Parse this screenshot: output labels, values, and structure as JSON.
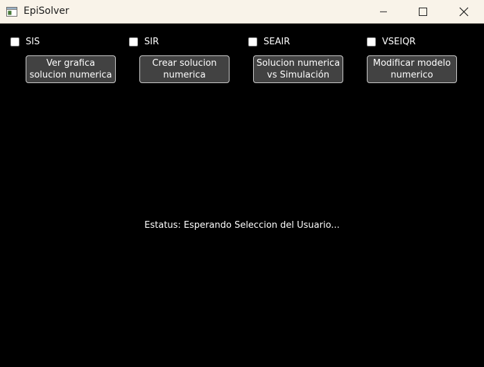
{
  "window": {
    "title": "EpiSolver",
    "icon": "app-window-icon",
    "controls": {
      "minimize_icon": "minimize-icon",
      "maximize_icon": "maximize-icon",
      "close_icon": "close-icon"
    }
  },
  "checkboxes": [
    {
      "label": "SIS",
      "checked": false
    },
    {
      "label": "SIR",
      "checked": false
    },
    {
      "label": "SEAIR",
      "checked": false
    },
    {
      "label": "VSEIQR",
      "checked": false
    }
  ],
  "buttons": [
    {
      "line1": "Ver grafica",
      "line2": "solucion numerica"
    },
    {
      "line1": "Crear solucion",
      "line2": "numerica"
    },
    {
      "line1": "Solucion numerica",
      "line2": "vs Simulación"
    },
    {
      "line1": "Modificar modelo",
      "line2": "numerico"
    }
  ],
  "status": {
    "text": "Estatus: Esperando Seleccion del Usuario..."
  },
  "colors": {
    "background": "#000000",
    "titlebar": "#f9f3e9",
    "button_bg": "#424242",
    "button_border": "#cfcfcf",
    "text": "#ffffff"
  }
}
